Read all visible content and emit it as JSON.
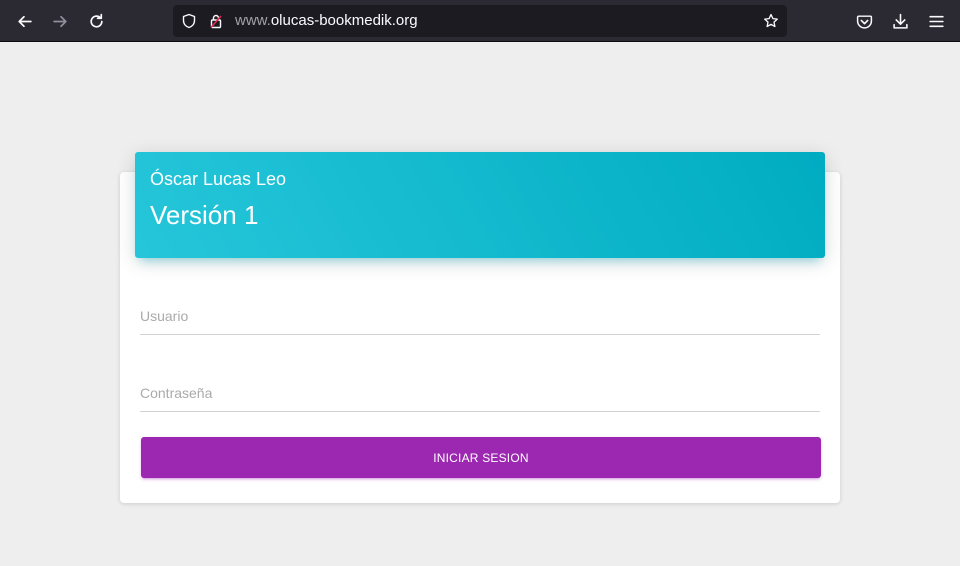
{
  "browser": {
    "url_prefix": "www.",
    "url_domain": "olucas-bookmedik.org",
    "icons": [
      "back-arrow-icon",
      "forward-arrow-icon",
      "reload-icon",
      "shield-icon",
      "lock-icon",
      "star-icon",
      "pocket-icon",
      "download-icon",
      "menu-icon"
    ]
  },
  "login": {
    "author": "Óscar Lucas Leo",
    "version": "Versión 1",
    "username_placeholder": "Usuario",
    "password_placeholder": "Contraseña",
    "submit_label": "INICIAR SESION"
  },
  "colors": {
    "header_gradient_start": "#26c6da",
    "header_gradient_end": "#00acc1",
    "button": "#9c27b0",
    "background": "#eeeeee",
    "toolbar": "#2b2a33"
  }
}
